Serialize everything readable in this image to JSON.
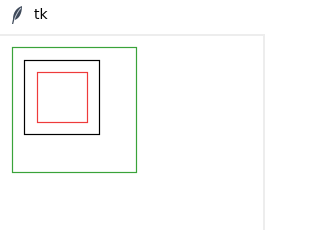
{
  "window": {
    "title": "tk",
    "icon": "feather-icon"
  },
  "canvas": {
    "shapes": [
      {
        "name": "outer-green-square",
        "type": "rectangle",
        "outline_color": "#3aa33a"
      },
      {
        "name": "middle-black-square",
        "type": "rectangle",
        "outline_color": "#000000"
      },
      {
        "name": "inner-red-square",
        "type": "rectangle",
        "outline_color": "#ee3b3b"
      }
    ]
  }
}
